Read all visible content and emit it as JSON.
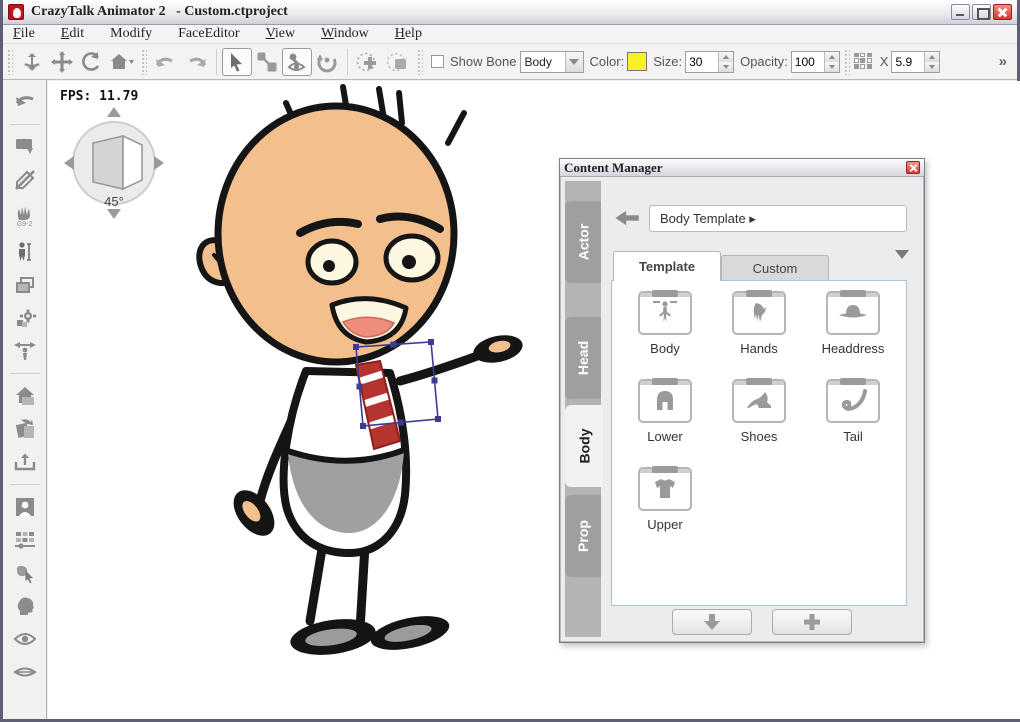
{
  "window": {
    "title": "CrazyTalk Animator 2   - Custom.ctproject"
  },
  "menu": {
    "items": [
      {
        "label": "File",
        "u": 0
      },
      {
        "label": "Edit",
        "u": 0
      },
      {
        "label": "Modify",
        "u": -1
      },
      {
        "label": "FaceEditor",
        "u": -1
      },
      {
        "label": "View",
        "u": 0
      },
      {
        "label": "Window",
        "u": 0
      },
      {
        "label": "Help",
        "u": 0
      }
    ]
  },
  "toolbar": {
    "show_bone_label": "Show Bone",
    "bone_target_value": "Body",
    "color_label": "Color:",
    "color_value": "#f8f127",
    "size_label": "Size:",
    "size_value": "30",
    "opacity_label": "Opacity:",
    "opacity_value": "100",
    "x_label": "X",
    "x_value": "5.9",
    "more_label": "»",
    "tool_icons": [
      "camera-zoom",
      "pan",
      "rotate-view",
      "home",
      "undo",
      "redo",
      "select",
      "link-bone",
      "bone-visibility",
      "rotate-pivot",
      "add-circle-mask",
      "add-rect-mask",
      "grid-layout"
    ]
  },
  "sidebar": {
    "hand_badge": "G9-2",
    "tool_icons": [
      "back-curve",
      "stamp-apply",
      "pencil-off",
      "hand-gesture",
      "actor-scale",
      "layers",
      "gear-parts",
      "person-flip",
      "home-drop",
      "page-rotate",
      "export-tray",
      "portrait",
      "grid-slider",
      "cursor-pick",
      "head",
      "eye",
      "mouth"
    ]
  },
  "canvas": {
    "fps_label": "FPS: 11.79",
    "nav_angle": "45°"
  },
  "content_manager": {
    "title": "Content Manager",
    "side_tabs": [
      {
        "label": "Actor",
        "active": false
      },
      {
        "label": "Head",
        "active": false
      },
      {
        "label": "Body",
        "active": true
      },
      {
        "label": "Prop",
        "active": false
      }
    ],
    "breadcrumb": "Body Template ▸",
    "tabs": [
      {
        "label": "Template",
        "active": true
      },
      {
        "label": "Custom",
        "active": false
      }
    ],
    "items": [
      {
        "label": "Body",
        "icon": "body-icon"
      },
      {
        "label": "Hands",
        "icon": "hands-icon"
      },
      {
        "label": "Headdress",
        "icon": "headdress-icon"
      },
      {
        "label": "Lower",
        "icon": "lower-icon"
      },
      {
        "label": "Shoes",
        "icon": "shoes-icon"
      },
      {
        "label": "Tail",
        "icon": "tail-icon"
      },
      {
        "label": "Upper",
        "icon": "upper-icon"
      }
    ],
    "bottom_buttons": [
      "apply-down-button",
      "add-button"
    ]
  }
}
